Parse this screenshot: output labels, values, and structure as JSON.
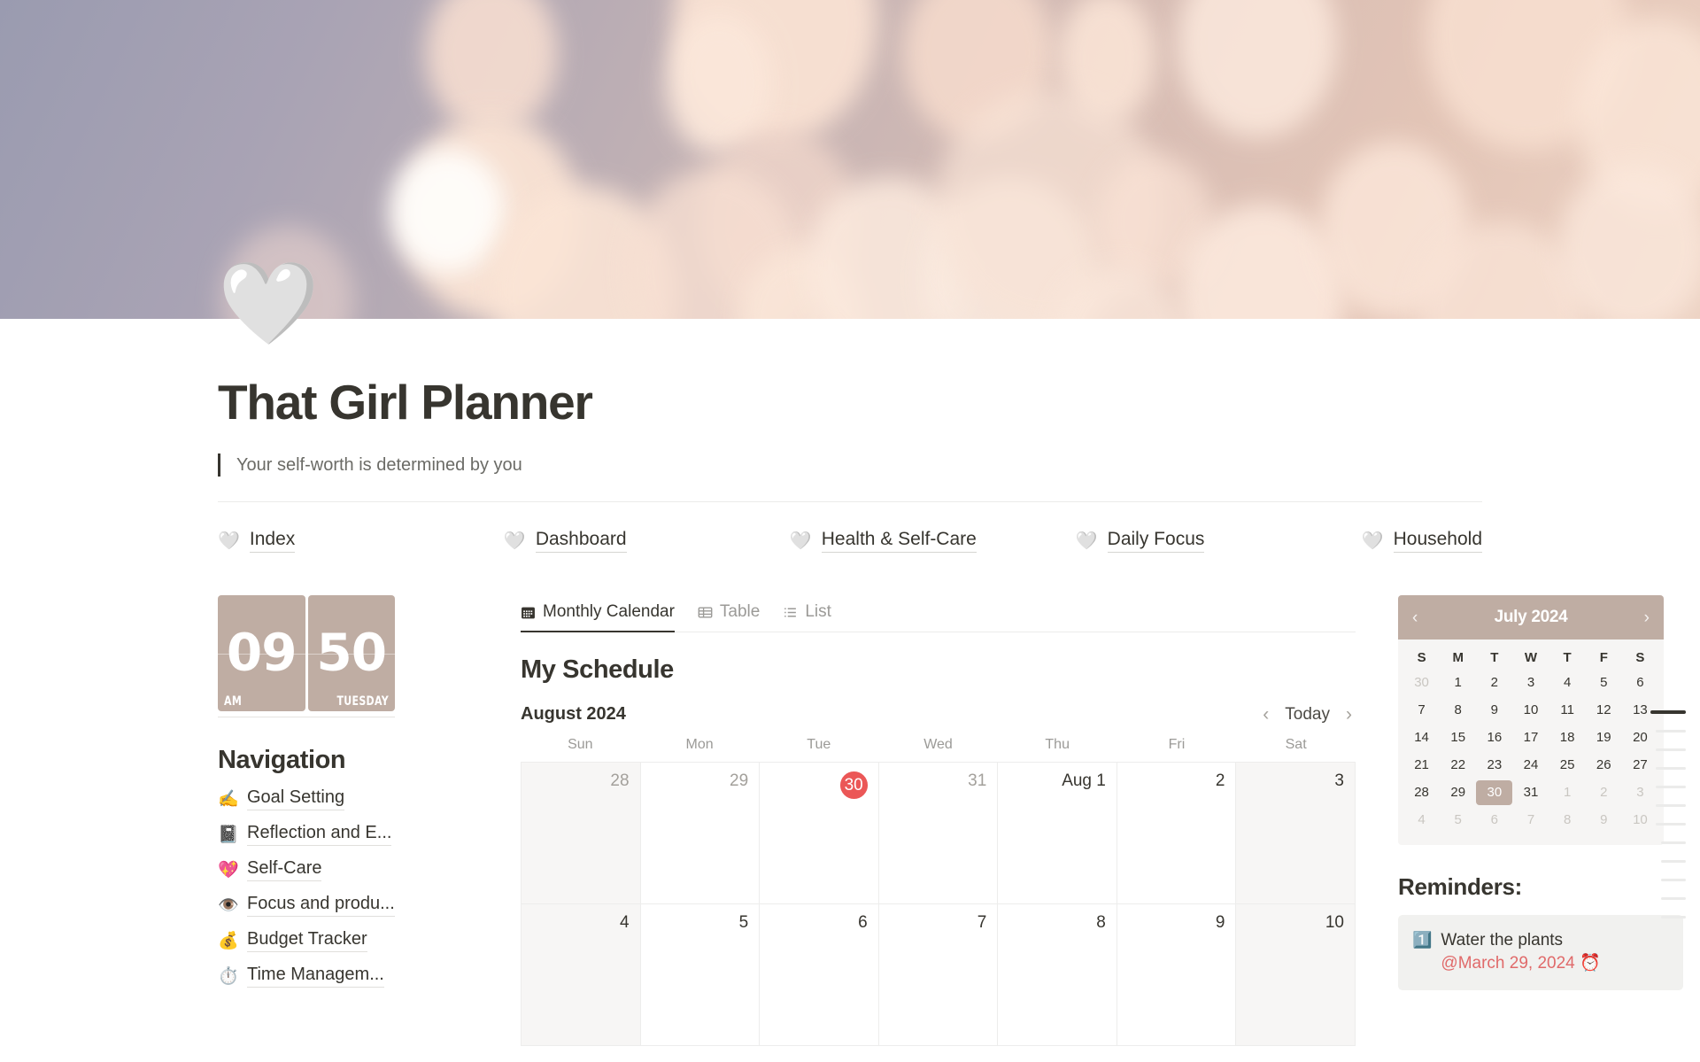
{
  "cover": {
    "alt": "bokeh-lights-cover"
  },
  "page": {
    "icon": "🤍",
    "title": "That Girl Planner",
    "quote": "Your self-worth is determined by you"
  },
  "topnav": [
    {
      "emoji": "🤍",
      "label": "Index"
    },
    {
      "emoji": "🤍",
      "label": "Dashboard"
    },
    {
      "emoji": "🤍",
      "label": "Health & Self-Care"
    },
    {
      "emoji": "🤍",
      "label": "Daily Focus"
    },
    {
      "emoji": "🤍",
      "label": "Household"
    }
  ],
  "clock": {
    "hours": "09",
    "minutes": "50",
    "meridiem": "AM",
    "weekday": "TUESDAY"
  },
  "navigation": {
    "title": "Navigation",
    "items": [
      {
        "emoji": "✍️",
        "label": "Goal Setting"
      },
      {
        "emoji": "📓",
        "label": "Reflection and E..."
      },
      {
        "emoji": "💖",
        "label": "Self-Care"
      },
      {
        "emoji": "👁️",
        "label": "Focus and produ..."
      },
      {
        "emoji": "💰",
        "label": "Budget Tracker"
      },
      {
        "emoji": "⏱️",
        "label": "Time Managem..."
      }
    ]
  },
  "tabs": [
    {
      "label": "Monthly Calendar",
      "icon": "calendar-icon",
      "active": true
    },
    {
      "label": "Table",
      "icon": "table-icon",
      "active": false
    },
    {
      "label": "List",
      "icon": "list-icon",
      "active": false
    }
  ],
  "schedule": {
    "title": "My Schedule",
    "month_label": "August 2024",
    "today_label": "Today",
    "prev_label": "‹",
    "next_label": "›",
    "weekdays": [
      "Sun",
      "Mon",
      "Tue",
      "Wed",
      "Thu",
      "Fri",
      "Sat"
    ],
    "cells": [
      {
        "label": "28",
        "muted": true,
        "weekend": true,
        "today": false
      },
      {
        "label": "29",
        "muted": true,
        "weekend": false,
        "today": false
      },
      {
        "label": "30",
        "muted": false,
        "weekend": false,
        "today": true
      },
      {
        "label": "31",
        "muted": true,
        "weekend": false,
        "today": false
      },
      {
        "label": "Aug 1",
        "muted": false,
        "weekend": false,
        "today": false
      },
      {
        "label": "2",
        "muted": false,
        "weekend": false,
        "today": false
      },
      {
        "label": "3",
        "muted": false,
        "weekend": true,
        "today": false
      },
      {
        "label": "4",
        "muted": false,
        "weekend": true,
        "today": false
      },
      {
        "label": "5",
        "muted": false,
        "weekend": false,
        "today": false
      },
      {
        "label": "6",
        "muted": false,
        "weekend": false,
        "today": false
      },
      {
        "label": "7",
        "muted": false,
        "weekend": false,
        "today": false
      },
      {
        "label": "8",
        "muted": false,
        "weekend": false,
        "today": false
      },
      {
        "label": "9",
        "muted": false,
        "weekend": false,
        "today": false
      },
      {
        "label": "10",
        "muted": false,
        "weekend": true,
        "today": false
      }
    ]
  },
  "mini_calendar": {
    "title": "July 2024",
    "prev_label": "‹",
    "next_label": "›",
    "weekdays": [
      "S",
      "M",
      "T",
      "W",
      "T",
      "F",
      "S"
    ],
    "days": [
      {
        "label": "30",
        "muted": true
      },
      {
        "label": "1",
        "muted": false
      },
      {
        "label": "2",
        "muted": false
      },
      {
        "label": "3",
        "muted": false
      },
      {
        "label": "4",
        "muted": false
      },
      {
        "label": "5",
        "muted": false
      },
      {
        "label": "6",
        "muted": false
      },
      {
        "label": "7",
        "muted": false
      },
      {
        "label": "8",
        "muted": false
      },
      {
        "label": "9",
        "muted": false
      },
      {
        "label": "10",
        "muted": false
      },
      {
        "label": "11",
        "muted": false
      },
      {
        "label": "12",
        "muted": false
      },
      {
        "label": "13",
        "muted": false
      },
      {
        "label": "14",
        "muted": false
      },
      {
        "label": "15",
        "muted": false
      },
      {
        "label": "16",
        "muted": false
      },
      {
        "label": "17",
        "muted": false
      },
      {
        "label": "18",
        "muted": false
      },
      {
        "label": "19",
        "muted": false
      },
      {
        "label": "20",
        "muted": false
      },
      {
        "label": "21",
        "muted": false
      },
      {
        "label": "22",
        "muted": false
      },
      {
        "label": "23",
        "muted": false
      },
      {
        "label": "24",
        "muted": false
      },
      {
        "label": "25",
        "muted": false
      },
      {
        "label": "26",
        "muted": false
      },
      {
        "label": "27",
        "muted": false
      },
      {
        "label": "28",
        "muted": false
      },
      {
        "label": "29",
        "muted": false
      },
      {
        "label": "30",
        "muted": false,
        "selected": true
      },
      {
        "label": "31",
        "muted": false
      },
      {
        "label": "1",
        "muted": true
      },
      {
        "label": "2",
        "muted": true
      },
      {
        "label": "3",
        "muted": true
      },
      {
        "label": "4",
        "muted": true
      },
      {
        "label": "5",
        "muted": true
      },
      {
        "label": "6",
        "muted": true
      },
      {
        "label": "7",
        "muted": true
      },
      {
        "label": "8",
        "muted": true
      },
      {
        "label": "9",
        "muted": true
      },
      {
        "label": "10",
        "muted": true
      }
    ]
  },
  "reminders": {
    "title": "Reminders:",
    "items": [
      {
        "emoji": "1️⃣",
        "text": "Water the plants",
        "date": "@March 29, 2024 ⏰"
      }
    ]
  },
  "colors": {
    "accent_taupe": "#bfada3",
    "today_red": "#eb5757",
    "reminder_red": "#e06a6a",
    "text": "#37352f",
    "muted_text": "#9b9a97",
    "weekend_bg": "#f7f6f5",
    "card_bg": "#f1f1ef"
  },
  "outline_rail": {
    "count": 12,
    "active_index": 0
  }
}
